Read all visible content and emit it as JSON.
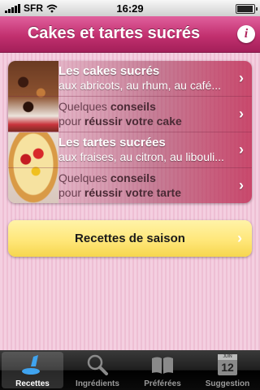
{
  "status_bar": {
    "carrier": "SFR",
    "time": "16:29"
  },
  "nav": {
    "title": "Cakes et tartes sucrés",
    "info_label": "i"
  },
  "menu": {
    "rows": [
      {
        "title": "Les cakes sucrés",
        "subtitle": "aux abricots, au rhum, au café..."
      },
      {
        "line1_plain": "Quelques ",
        "line1_bold": "conseils",
        "line2_plain": "pour ",
        "line2_bold": "réussir votre cake"
      },
      {
        "title": "Les tartes sucrées",
        "subtitle": "aux fraises, au citron, au libouli..."
      },
      {
        "line1_plain": "Quelques ",
        "line1_bold": "conseils",
        "line2_plain": "pour ",
        "line2_bold": "réussir votre tarte"
      }
    ],
    "chevron": "›"
  },
  "season_button": {
    "label": "Recettes de saison"
  },
  "tabs": [
    {
      "label": "Recettes",
      "icon": "whisk-icon",
      "active": true
    },
    {
      "label": "Ingrédients",
      "icon": "magnifier-icon",
      "active": false
    },
    {
      "label": "Préférées",
      "icon": "book-icon",
      "active": false
    },
    {
      "label": "Suggestion",
      "icon": "calendar-icon",
      "active": false,
      "calendar_month": "JUIN",
      "calendar_day": "12"
    }
  ],
  "colors": {
    "nav_pink": "#c2306f",
    "accent_blue": "#3fa3ef",
    "season_yellow": "#ffe77a"
  }
}
